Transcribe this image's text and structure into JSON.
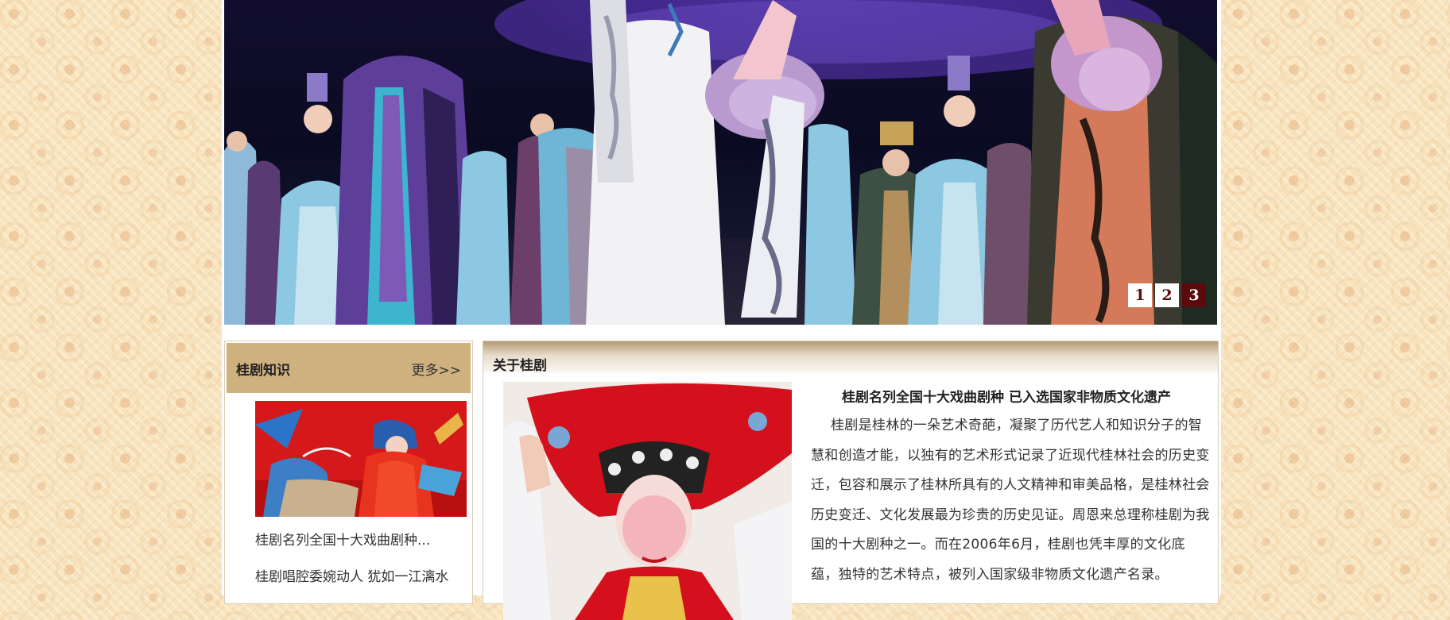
{
  "banner": {
    "image": "opera-stage-curtain-call",
    "pager": [
      "1",
      "2",
      "3"
    ],
    "active_page": "3"
  },
  "knowledge": {
    "title": "桂剧知识",
    "more": "更多>>",
    "image": "opera-performer-in-costume",
    "items": [
      "桂剧名列全国十大戏曲剧种...",
      "桂剧唱腔委婉动人 犹如一江漓水"
    ]
  },
  "about": {
    "title": "关于桂剧",
    "image": "opera-actress-red-veil",
    "headline": "桂剧名列全国十大戏曲剧种 已入选国家非物质文化遗产",
    "body": "桂剧是桂林的一朵艺术奇葩，凝聚了历代艺人和知识分子的智慧和创造才能，以独有的艺术形式记录了近现代桂林社会的历史变迁，包容和展示了桂林所具有的人文精神和审美品格，是桂林社会历史变迁、文化发展最为珍贵的历史见证。周恩来总理称桂剧为我国的十大剧种之一。而在2006年6月，桂剧也凭丰厚的文化底蕴，独特的艺术特点，被列入国家级非物质文化遗产名录。"
  },
  "colors": {
    "panel_header": "#cfb07f",
    "pager_active": "#5a0a0a",
    "page_background": "#f7e4bf"
  }
}
